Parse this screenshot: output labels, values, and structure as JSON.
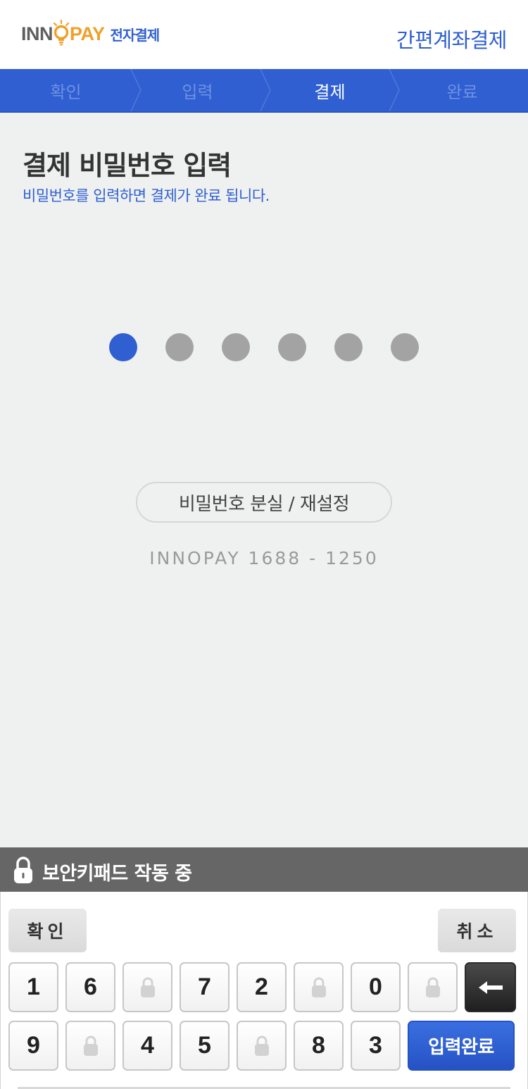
{
  "header": {
    "logo_left": "INN",
    "logo_right": "PAY",
    "logo_sub": "전자결제",
    "title": "간편계좌결제"
  },
  "steps": [
    {
      "label": "확인",
      "active": false
    },
    {
      "label": "입력",
      "active": false
    },
    {
      "label": "결제",
      "active": true
    },
    {
      "label": "완료",
      "active": false
    }
  ],
  "content": {
    "title": "결제 비밀번호 입력",
    "subtitle": "비밀번호를 입력하면 결제가 완료 됩니다.",
    "pin": {
      "length": 6,
      "entered": 1
    },
    "reset_label": "비밀번호 분실 / 재설정",
    "phone_text": "INNOPAY 1688 - 1250"
  },
  "keypad": {
    "bar_text": "보안키패드 작동 중",
    "confirm_label": "확인",
    "cancel_label": "취소",
    "row1": [
      "1",
      "6",
      "",
      "7",
      "2",
      "",
      "0",
      ""
    ],
    "row2": [
      "9",
      "",
      "4",
      "5",
      "",
      "8",
      "3"
    ],
    "done_label": "입력완료",
    "backspace_icon": "arrow-left-icon",
    "blank_key_icon": "lock-icon"
  },
  "colors": {
    "brand_blue": "#2f5fd0",
    "brand_orange": "#f0a02a",
    "dot_empty": "#a3a3a3",
    "bar_gray": "#666666"
  }
}
